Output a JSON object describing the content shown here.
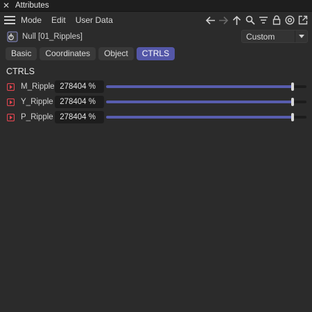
{
  "window": {
    "title": "Attributes",
    "close_glyph": "✕"
  },
  "menu": {
    "items": [
      "Mode",
      "Edit",
      "User Data"
    ]
  },
  "toolbar": {
    "icons": [
      "arrow-left-icon",
      "arrow-right-icon",
      "arrow-up-icon",
      "search-icon",
      "filter-icon",
      "lock-icon",
      "target-icon",
      "open-window-icon"
    ]
  },
  "object": {
    "icon": "null-object-icon",
    "name": "Null [01_Ripples]"
  },
  "preset": {
    "value": "Custom"
  },
  "tabs": [
    {
      "label": "Basic",
      "active": false
    },
    {
      "label": "Coordinates",
      "active": false
    },
    {
      "label": "Object",
      "active": false
    },
    {
      "label": "CTRLS",
      "active": true
    }
  ],
  "section": {
    "title": "CTRLS"
  },
  "params": [
    {
      "label": "M_Ripple",
      "value": "278404 %",
      "slider_level": 0.93
    },
    {
      "label": "Y_Ripple",
      "value": "278404 %",
      "slider_level": 0.93
    },
    {
      "label": "P_Ripple",
      "value": "278404 %",
      "slider_level": 0.93
    }
  ],
  "colors": {
    "accent": "#5457a8",
    "keyframe": "#e0454f",
    "background": "#2b2b2b"
  }
}
